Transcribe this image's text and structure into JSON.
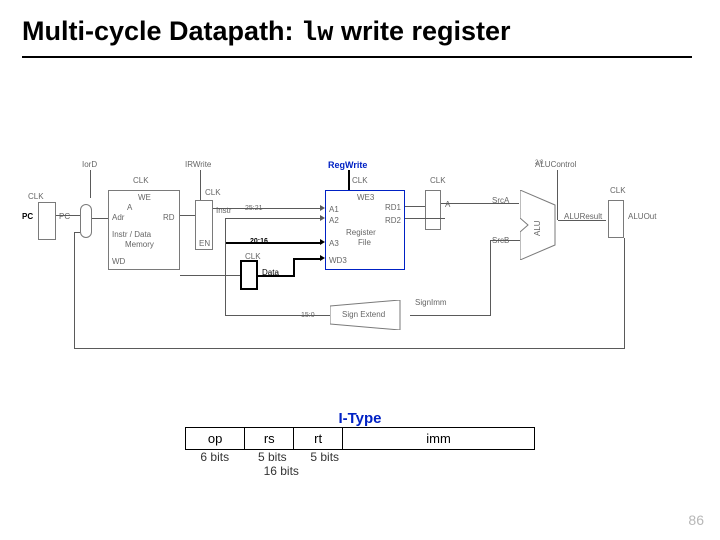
{
  "title_prefix": "Multi-cycle Datapath: ",
  "title_mono": "lw",
  "title_suffix": " write register",
  "page_number": "86",
  "signals": {
    "iord": "IorD",
    "irwrite": "IRWrite",
    "regwrite": "RegWrite",
    "aluctrl": "ALUControl",
    "aluctrl_sub": "2:0",
    "srca": "SrcA",
    "srcb": "SrcB",
    "clk": "CLK"
  },
  "blocks": {
    "pc": "PC",
    "adr": "Adr",
    "we": "WE",
    "a_port": "A",
    "rd_port": "RD",
    "imem": "Instr / Data",
    "imem2": "Memory",
    "wd": "WD",
    "en": "EN",
    "instr": "Instr",
    "data": "Data",
    "a1": "A1",
    "a2": "A2",
    "a3": "A3",
    "wd3": "WD3",
    "we3": "WE3",
    "rd1": "RD1",
    "rd2": "RD2",
    "regfile": "Register",
    "regfile2": "File",
    "a_reg": "A",
    "alu": "ALU",
    "aluresult": "ALUResult",
    "aluout": "ALUOut",
    "signext": "Sign Extend",
    "signimm": "SignImm",
    "slice2521": "25:21",
    "slice2016": "20:16",
    "slice150": "15:0"
  },
  "itype": {
    "title": "I-Type",
    "cols": [
      "op",
      "rs",
      "rt",
      "imm"
    ],
    "bits": [
      "6 bits",
      "5 bits",
      "5 bits",
      "16 bits"
    ]
  }
}
